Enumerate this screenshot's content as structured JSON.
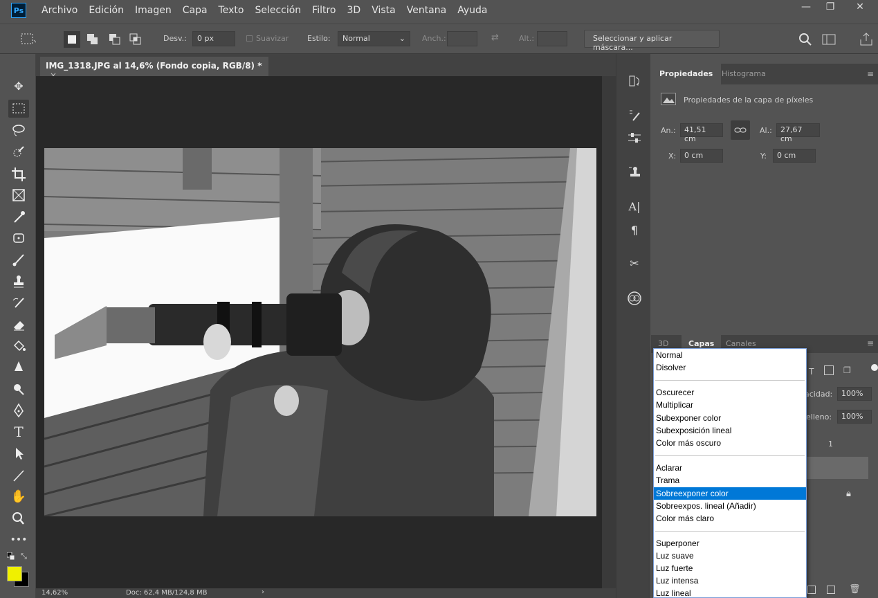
{
  "app": {
    "logo": "Ps"
  },
  "menu": [
    "Archivo",
    "Edición",
    "Imagen",
    "Capa",
    "Texto",
    "Selección",
    "Filtro",
    "3D",
    "Vista",
    "Ventana",
    "Ayuda"
  ],
  "window_controls": {
    "minimize": "—",
    "maximize": "❐",
    "close": "✕"
  },
  "options": {
    "desv_label": "Desv.:",
    "desv_value": "0 px",
    "suavizar_label": "Suavizar",
    "estilo_label": "Estilo:",
    "estilo_value": "Normal",
    "anch_label": "Anch.:",
    "alt_label": "Alt.:",
    "mask_button": "Seleccionar y aplicar máscara..."
  },
  "document": {
    "tab_title": "IMG_1318.JPG al 14,6% (Fondo copia, RGB/8) *",
    "zoom": "14,62%",
    "doc_info": "Doc: 62,4 MB/124,8 MB",
    "foreground_color": "#f0f000",
    "background_color": "#000000"
  },
  "properties": {
    "tabs": [
      "Propiedades",
      "Histograma"
    ],
    "section_title": "Propiedades de la capa de píxeles",
    "an_label": "An.:",
    "an_value": "41,51 cm",
    "al_label": "Al.:",
    "al_value": "27,67 cm",
    "x_label": "X:",
    "x_value": "0 cm",
    "y_label": "Y:",
    "y_value": "0 cm"
  },
  "layers": {
    "tabs": [
      "3D",
      "Capas",
      "Canales"
    ],
    "opacity_label": "acidad:",
    "opacity_value": "100%",
    "fill_label": "elleno:",
    "fill_value": "100%",
    "layer_partial": "1"
  },
  "blend_modes": {
    "selected": "Sobreexponer color",
    "groups": [
      [
        "Normal",
        "Disolver"
      ],
      [
        "Oscurecer",
        "Multiplicar",
        "Subexponer color",
        "Subexposición lineal",
        "Color más oscuro"
      ],
      [
        "Aclarar",
        "Trama",
        "Sobreexponer color",
        "Sobreexpos. lineal (Añadir)",
        "Color más claro"
      ],
      [
        "Superponer",
        "Luz suave",
        "Luz fuerte",
        "Luz intensa",
        "Luz lineal"
      ]
    ]
  }
}
